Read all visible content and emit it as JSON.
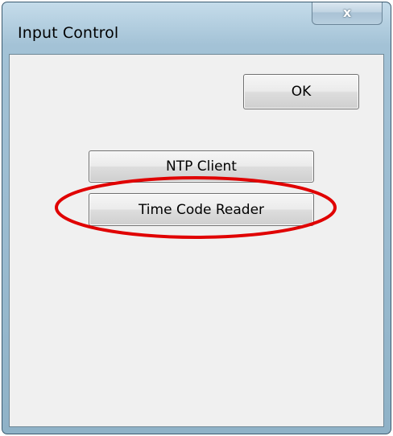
{
  "window": {
    "title": "Input Control",
    "close_glyph": "x"
  },
  "buttons": {
    "ok_label": "OK",
    "ntp_label": "NTP Client",
    "time_code_label": "Time Code Reader"
  },
  "annotation": {
    "shape": "ellipse",
    "color": "#e00000",
    "highlights": "Time Code Reader"
  },
  "colors": {
    "frame": "#9abbd0",
    "client_bg": "#f0f0f0"
  }
}
